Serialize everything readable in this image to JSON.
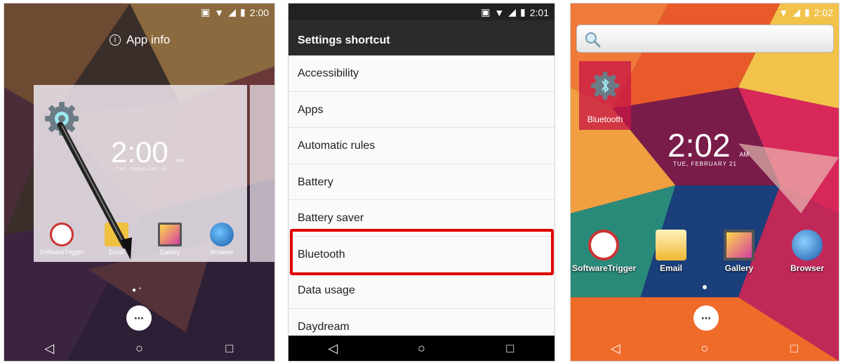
{
  "panel1": {
    "status_time": "2:00",
    "app_info_label": "App info",
    "preview_clock": "2:00",
    "preview_clock_ampm": "AM",
    "preview_date": "TUE, FEBRUARY 21",
    "apps": [
      "SoftwareTrigger",
      "Email",
      "Gallery",
      "Browser"
    ]
  },
  "panel2": {
    "status_time": "2:01",
    "header_title": "Settings shortcut",
    "items": [
      "Accessibility",
      "Apps",
      "Automatic rules",
      "Battery",
      "Battery saver",
      "Bluetooth",
      "Data usage",
      "Daydream"
    ],
    "highlighted": "Bluetooth"
  },
  "panel3": {
    "status_time": "2:02",
    "bt_widget_label": "Bluetooth",
    "clock": "2:02",
    "clock_ampm": "AM",
    "date": "TUE, FEBRUARY 21",
    "apps": [
      "SoftwareTrigger",
      "Email",
      "Gallery",
      "Browser"
    ]
  },
  "colors": {
    "highlight": "#e00000",
    "settings_header": "#2b2b2b"
  },
  "icons": {
    "back": "back-triangle-icon",
    "home": "home-circle-icon",
    "recents": "recents-square-icon"
  }
}
